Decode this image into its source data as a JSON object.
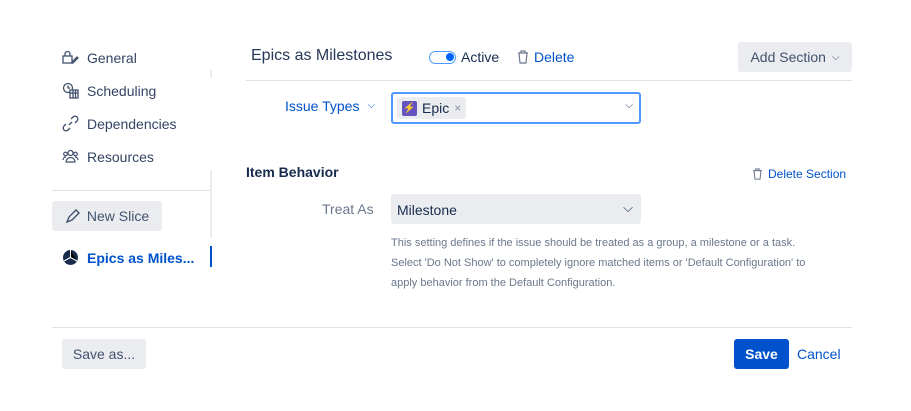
{
  "sidebar": {
    "items": [
      {
        "label": "General"
      },
      {
        "label": "Scheduling"
      },
      {
        "label": "Dependencies"
      },
      {
        "label": "Resources"
      }
    ],
    "new_slice": "New Slice",
    "active_slice": "Epics as Miles..."
  },
  "header": {
    "title": "Epics as Milestones",
    "toggle_label": "Active",
    "toggle_on": true,
    "delete": "Delete",
    "add_section": "Add Section"
  },
  "issue_types": {
    "label": "Issue Types",
    "tag": "Epic"
  },
  "item_behavior": {
    "title": "Item Behavior",
    "delete_section": "Delete Section",
    "treat_as_label": "Treat As",
    "treat_as_value": "Milestone",
    "help": [
      "This setting defines if the issue should be treated as a group, a milestone or a task.",
      "Select 'Do Not Show' to completely ignore matched items or 'Default Configuration' to",
      "apply behavior from the Default Configuration."
    ]
  },
  "footer": {
    "save_as": "Save as...",
    "save": "Save",
    "cancel": "Cancel"
  },
  "colors": {
    "accent": "#0052cc",
    "epic": "#6554c0"
  }
}
